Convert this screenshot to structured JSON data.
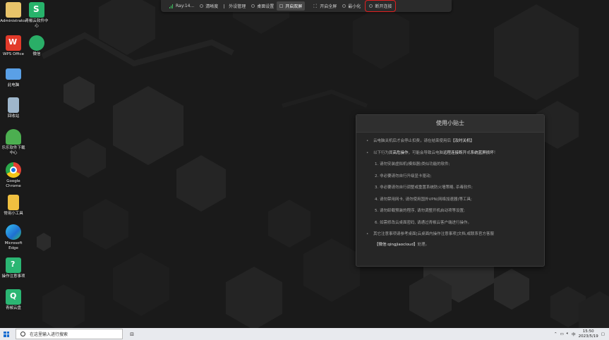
{
  "desktop_icons": [
    {
      "id": "admin",
      "label": "Administrator",
      "color": "#e8c46a",
      "icon": "folder-user-icon"
    },
    {
      "id": "qingjiao-center",
      "label": "青椒云软件中心",
      "color": "#27b36b",
      "icon": "qingjiao-s-icon"
    },
    {
      "id": "wps",
      "label": "WPS Office",
      "color": "#e23a2a",
      "icon": "wps-icon"
    },
    {
      "id": "wechat",
      "label": "微信",
      "color": "#2aae67",
      "icon": "wechat-icon"
    },
    {
      "id": "this-pc",
      "label": "此电脑",
      "color": "#5aa0e6",
      "icon": "computer-icon"
    },
    {
      "id": "recycle",
      "label": "回收站",
      "color": "#9fb7cc",
      "icon": "recycle-bin-icon"
    },
    {
      "id": "download-center",
      "label": "乐乐软件下载中心",
      "color": "#4caf50",
      "icon": "tree-icon"
    },
    {
      "id": "chrome",
      "label": "Google Chrome",
      "color": "#e34133",
      "icon": "chrome-icon"
    },
    {
      "id": "tools",
      "label": "常用小工具",
      "color": "#f0c040",
      "icon": "tools-folder-icon"
    },
    {
      "id": "edge",
      "label": "Microsoft Edge",
      "color": "#1f9be8",
      "icon": "edge-icon"
    },
    {
      "id": "notes",
      "label": "操作注意事项",
      "color": "#2bb673",
      "icon": "note-icon"
    },
    {
      "id": "cloud-disk",
      "label": "青椒云盘",
      "color": "#2bb673",
      "icon": "cloud-disk-icon"
    }
  ],
  "toolbar": {
    "items": [
      {
        "label": "Ray:14...",
        "icon": "signal-icon"
      },
      {
        "label": "清晰度",
        "icon": "clarity-icon"
      },
      {
        "label": "外设管理",
        "icon": "peripheral-icon"
      },
      {
        "label": "桌面设置",
        "icon": "desktop-settings-icon"
      },
      {
        "label": "开启双屏",
        "icon": "dual-screen-icon"
      },
      {
        "label": "开启全屏",
        "icon": "fullscreen-icon"
      },
      {
        "label": "最小化",
        "icon": "minimize-icon"
      },
      {
        "label": "断开连接",
        "icon": "disconnect-icon"
      }
    ]
  },
  "tips": {
    "title": "使用小贴士",
    "line1_a": "云电脑关机后才会停止扣费，请在结束使用后",
    "line1_b": "【及时关机】",
    "line2_a": "以下行为属",
    "line2_b": "高危操作",
    "line2_c": "，可能会导致云电脑",
    "line2_d": "远程连接断开",
    "line2_e": "或",
    "line2_f": "系统蓝屏损坏",
    "line2_g": "！",
    "subs": [
      "1. 请勿安装虚拟机(模拟器)类似功能的软件;",
      "2. 非必要请勿自行升级显卡驱动;",
      "3. 非必要请勿自行调整或重置系统防火墙策略, 杀毒软件;",
      "4. 请勿禁用网卡, 请勿使用国外VPN(网络加速器)等工具;",
      "5. 请勿卸载预装的程序, 请勿调整开机启动项等设置;",
      "6. 如需修改云桌面密码, 请通过青椒云客户端进行操作。"
    ],
    "line3": "其它注意事项请参考桌面[云桌面内操作注意事项]文档,或联系官方客服",
    "line4_a": "【微信:qingjiaocloud】",
    "line4_b": "处理。"
  },
  "taskbar": {
    "search_placeholder": "在这里输入进行搜索",
    "time": "15:50",
    "date": "2023/5/19"
  }
}
